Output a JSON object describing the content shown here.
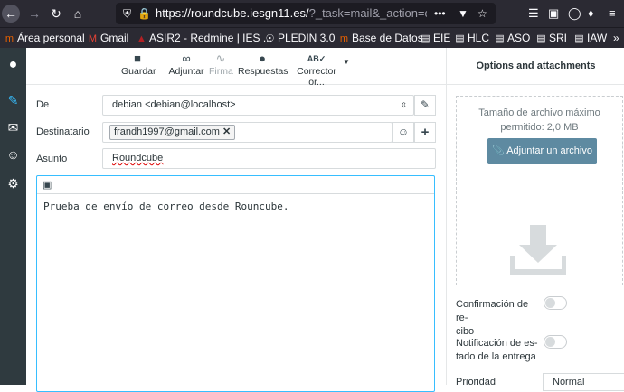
{
  "browser": {
    "url_main": "https://roundcube.iesgn11.es/",
    "url_rest": "?_task=mail&_action=compose",
    "bookmarks": [
      "Área personal",
      "Gmail",
      "ASIR2 - Redmine | IES ...",
      "PLEDIN 3.0",
      "Base de Datos",
      "EIE",
      "HLC",
      "ASO",
      "SRI",
      "IAW"
    ]
  },
  "toolbar": {
    "save": "Guardar",
    "attach": "Adjuntar",
    "signature": "Firma",
    "responses": "Respuestas",
    "spellcheck": "Corrector or..."
  },
  "form": {
    "from_label": "De",
    "from_value": "debian <debian@localhost>",
    "to_label": "Destinatario",
    "to_chip": "frandh1997@gmail.com",
    "subject_label": "Asunto",
    "subject_value": "Roundcube",
    "body_text": "Prueba de envío de correo desde Rouncube."
  },
  "panel": {
    "title": "Options and attachments",
    "max_size_line1": "Tamaño de archivo máximo",
    "max_size_line2": "permitido: 2,0 MB",
    "attach_button": "Adjuntar un archivo",
    "receipt_line1": "Confirmación de re-",
    "receipt_line2": "cibo",
    "delivery_line1": "Notificación de es-",
    "delivery_line2": "tado de la entrega",
    "priority_label": "Prioridad",
    "priority_value": "Normal"
  }
}
